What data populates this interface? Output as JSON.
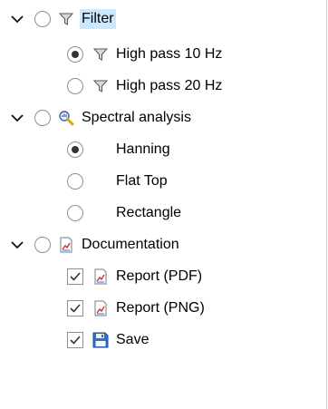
{
  "tree": {
    "filter": {
      "label": "Filter",
      "icon": "funnel-icon",
      "expanded": true,
      "checked": false,
      "selected": true,
      "children": [
        {
          "label": "High pass 10 Hz",
          "icon": "funnel-icon",
          "checked": true
        },
        {
          "label": "High pass 20 Hz",
          "icon": "funnel-icon",
          "checked": false
        }
      ]
    },
    "spectral": {
      "label": "Spectral analysis",
      "icon": "magnifier-chart-icon",
      "expanded": true,
      "checked": false,
      "children": [
        {
          "label": "Hanning",
          "checked": true
        },
        {
          "label": "Flat Top",
          "checked": false
        },
        {
          "label": "Rectangle",
          "checked": false
        }
      ]
    },
    "documentation": {
      "label": "Documentation",
      "icon": "report-chart-icon",
      "expanded": true,
      "checked": false,
      "children": [
        {
          "label": "Report (PDF)",
          "icon": "report-chart-icon",
          "checked": true
        },
        {
          "label": "Report (PNG)",
          "icon": "report-chart-icon",
          "checked": true
        },
        {
          "label": "Save",
          "icon": "floppy-disk-icon",
          "checked": true
        }
      ]
    }
  },
  "colors": {
    "selection": "#cce8ff",
    "control_border": "#8f8f8f",
    "check_mark": "#333333"
  }
}
